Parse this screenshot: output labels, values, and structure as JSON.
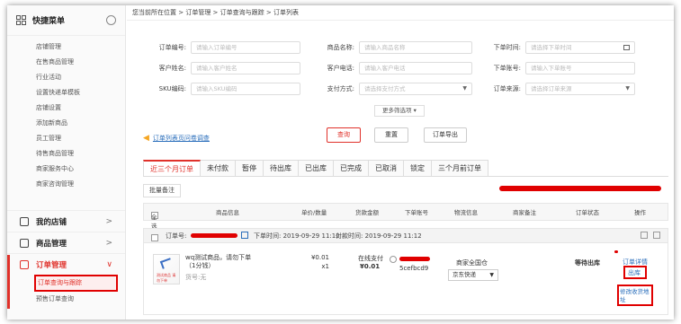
{
  "sidebar": {
    "title": "快捷菜单",
    "quick_items": [
      "店铺管理",
      "在售商品管理",
      "行业活动",
      "设置快递单模板",
      "店铺设置",
      "添加新商品",
      "员工管理",
      "待售商品管理",
      "商家服务中心",
      "商家咨询管理"
    ],
    "groups": [
      {
        "label": "我的店铺",
        "chevron": ">"
      },
      {
        "label": "商品管理",
        "chevron": ">"
      },
      {
        "label": "订单管理",
        "chevron": "∨"
      }
    ],
    "order_sub": [
      "订单查询与跟踪",
      "预售订单查询"
    ]
  },
  "breadcrumb": "您当前所在位置 > 订单管理 > 订单查询与跟踪 > 订单列表",
  "filters": {
    "order_no": {
      "label": "订单编号:",
      "placeholder": "请输入订单编号"
    },
    "product_name": {
      "label": "商品名称:",
      "placeholder": "请输入商品名称"
    },
    "order_time": {
      "label": "下单时间:",
      "placeholder": "请选择下单时间"
    },
    "customer_name": {
      "label": "客户姓名:",
      "placeholder": "请输入客户姓名"
    },
    "customer_phone": {
      "label": "客户电话:",
      "placeholder": "请输入客户电话"
    },
    "order_account": {
      "label": "下单账号:",
      "placeholder": "请输入下单账号"
    },
    "sku": {
      "label": "SKU编码:",
      "placeholder": "请输入SKU编码"
    },
    "pay_method": {
      "label": "支付方式:",
      "placeholder": "请选择支付方式"
    },
    "order_source": {
      "label": "订单来源:",
      "placeholder": "请选择订单来源"
    },
    "more_label": "更多筛选项 ▾"
  },
  "survey_link": "订单列表页问卷调查",
  "buttons": {
    "query": "查询",
    "reset": "重置",
    "export": "订单导出",
    "batch_note": "批量备注"
  },
  "tabs": [
    "近三个月订单",
    "未付款",
    "暂停",
    "待出库",
    "已出库",
    "已完成",
    "已取消",
    "锁定",
    "三个月前订单"
  ],
  "table_headers": {
    "select_all": "全选",
    "product": "商品信息",
    "price_qty": "单价/数量",
    "amount": "货款金额",
    "account": "下单账号",
    "logistics": "物流信息",
    "note": "商家备注",
    "status": "订单状态",
    "ops": "操作"
  },
  "order": {
    "no_label": "订单号:",
    "order_time": "下单时间: 2019-09-29 11:12",
    "pay_time": "付款时间: 2019-09-29 11:12",
    "product_title": "wq测试商品，请勿下单（1分钱）",
    "product_no": "货号:无",
    "thumb_text": "测试商品 请勿下单",
    "price": "¥0.01",
    "qty": "x1",
    "pay_type": "在线支付",
    "amount": "¥0.01",
    "account_suffix": "5cefbcd9",
    "logistics_scope": "商家全国仓",
    "courier": "京东快递",
    "status": "等待出库",
    "op_detail": "订单详情",
    "op_ship": "出库",
    "op_edit_addr": "修改收货地址"
  },
  "colors": {
    "accent": "#e0312a",
    "link": "#2a6ebb",
    "redaction": "#e00000"
  }
}
